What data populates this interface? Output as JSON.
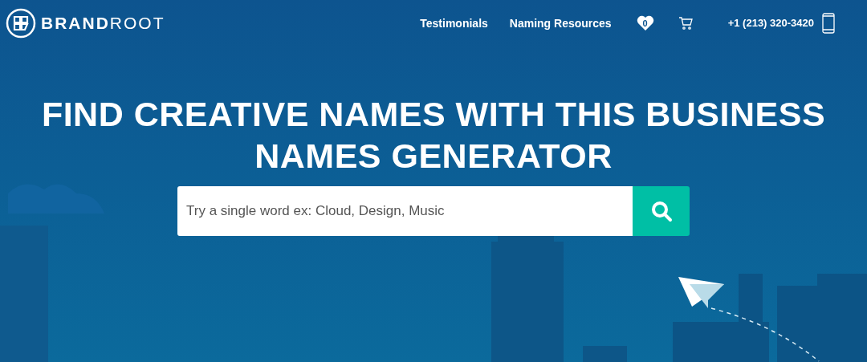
{
  "header": {
    "logo": "**BRAND**ROOT",
    "nav": [
      "Testimonials",
      "Naming Resources"
    ],
    "favorites_count": "0",
    "phone": "+1 (213) 320-3420"
  },
  "hero": {
    "title": "FIND CREATIVE NAMES WITH THIS BUSINESS NAMES GENERATOR",
    "search": {
      "placeholder": "Try a single word ex: Cloud, Design, Music"
    }
  }
}
